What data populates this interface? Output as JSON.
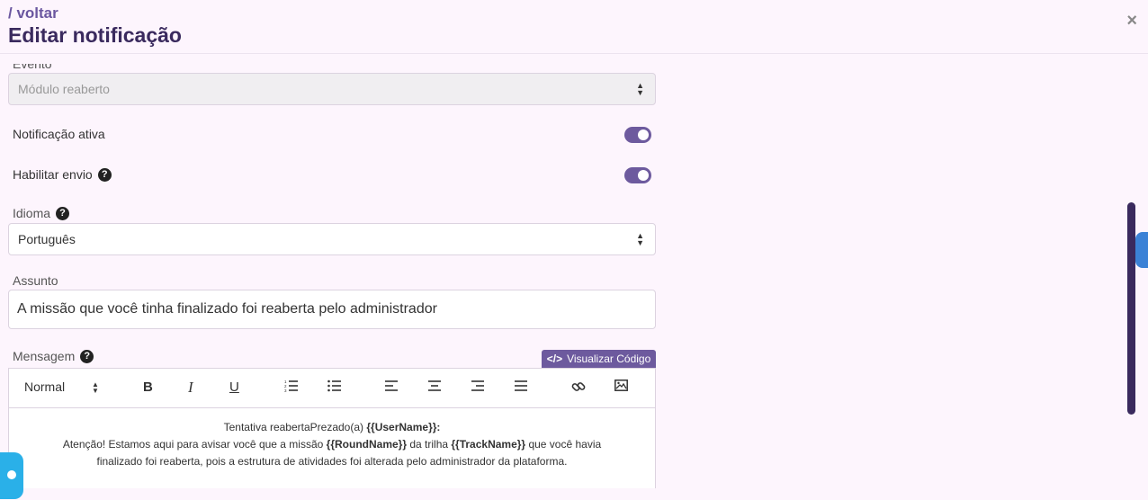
{
  "header": {
    "back_label": "/ voltar",
    "title": "Editar notificação",
    "close_label": "×"
  },
  "form": {
    "event_label": "Evento",
    "event_value": "Módulo reaberto",
    "active_label": "Notificação ativa",
    "active_on": true,
    "send_label": "Habilitar envio",
    "send_on": true,
    "language_label": "Idioma",
    "language_value": "Português",
    "subject_label": "Assunto",
    "subject_value": "A missão que você tinha finalizado foi reaberta pelo administrador",
    "message_label": "Mensagem",
    "view_code_label": "Visualizar Código"
  },
  "toolbar": {
    "format_value": "Normal",
    "bold": "B",
    "italic": "I",
    "underline": "U"
  },
  "message": {
    "line1_pre": "Tentativa reabertaPrezado(a) ",
    "line1_var": "{{UserName}}:",
    "line2_pre": "Atenção! Estamos aqui para avisar você que a missão ",
    "line2_var1": "{{RoundName}}",
    "line2_mid": " da trilha ",
    "line2_var2": "{{TrackName}}",
    "line2_post": " que você havia",
    "line3": "finalizado foi reaberta, pois a estrutura de atividades foi alterada pelo administrador da plataforma."
  },
  "help_glyph": "?",
  "colors": {
    "accent": "#6d5a9e",
    "title": "#3a2a5e",
    "background": "#fdf5fd"
  }
}
